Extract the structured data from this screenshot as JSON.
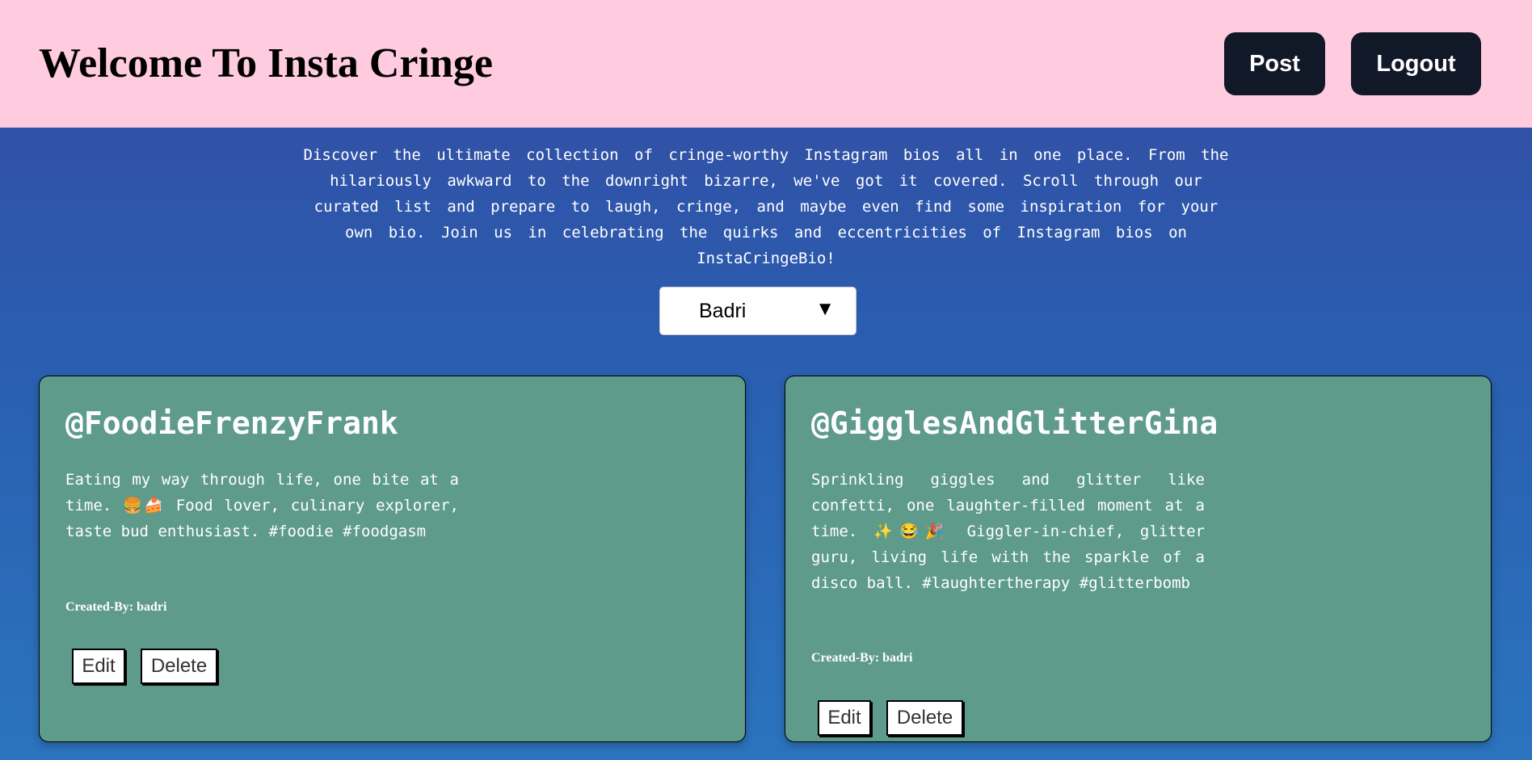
{
  "header": {
    "title": "Welcome To Insta Cringe",
    "post_label": "Post",
    "logout_label": "Logout"
  },
  "intro": {
    "text": "Discover the ultimate collection of cringe-worthy Instagram bios all in one place. From the hilariously awkward to the downright bizarre, we've got it covered. Scroll through our curated list and prepare to laugh, cringe, and maybe even find some inspiration for your own bio. Join us in celebrating the quirks and eccentricities of Instagram bios on InstaCringeBio!"
  },
  "user_select": {
    "value": "Badri",
    "arrow": "▼"
  },
  "cards": [
    {
      "handle": "@FoodieFrenzyFrank",
      "bio": "Eating my way through life, one bite at a time. 🍔🍰 Food lover, culinary explorer, taste bud enthusiast. #foodie #foodgasm",
      "created_by": "Created-By: badri",
      "edit_label": "Edit",
      "delete_label": "Delete"
    },
    {
      "handle": "@GigglesAndGlitterGina",
      "bio": "Sprinkling giggles and glitter like confetti, one laughter-filled moment at a time. ✨😂🎉 Giggler-in-chief, glitter guru, living life with the sparkle of a disco ball. #laughtertherapy #glitterbomb",
      "created_by": "Created-By: badri",
      "edit_label": "Edit",
      "delete_label": "Delete"
    }
  ],
  "colors": {
    "header_bg": "#ffccdf",
    "button_dark": "#111827",
    "card_bg": "#5e9b8b",
    "page_gradient_top": "#344ba0",
    "page_gradient_bottom": "#2b74bd"
  }
}
